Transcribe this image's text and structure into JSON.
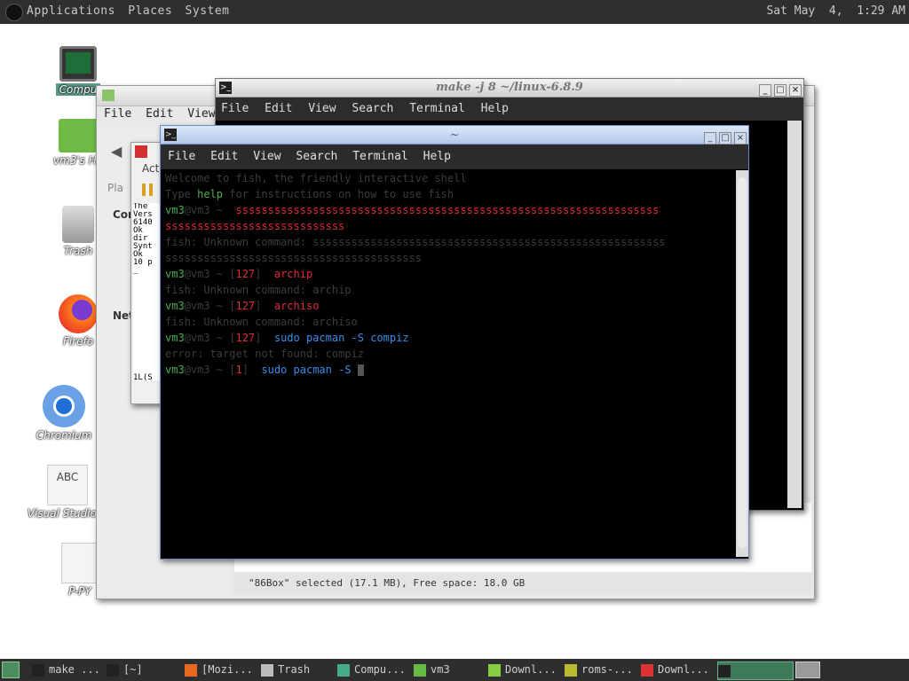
{
  "top_panel": {
    "menus": [
      "Applications",
      "Places",
      "System"
    ],
    "clock": "Sat May  4,  1:29 AM"
  },
  "desktop_icons": [
    {
      "label": "Compu",
      "icon": "computer-icon"
    },
    {
      "label": "vm3's Ho",
      "icon": "home-folder-icon"
    },
    {
      "label": "Trash",
      "icon": "trash-icon"
    },
    {
      "label": "Firefo",
      "icon": "firefox-icon"
    },
    {
      "label": "Chromium",
      "icon": "chromium-icon"
    },
    {
      "label": "Visual Studio C",
      "icon": "vscode-icon",
      "glyph": "ABC"
    },
    {
      "label": "P-PY",
      "icon": "file-icon"
    }
  ],
  "file_manager": {
    "menus": [
      "File",
      "Edit",
      "View"
    ],
    "status": "\"86Box\" selected (17.1 MB), Free space: 18.0 GB",
    "side_labels": [
      "Pla",
      "Cor",
      "Net"
    ],
    "toolbar_label": "Act"
  },
  "dialog": {
    "lines": [
      "The",
      "Vers",
      "6140",
      "Ok",
      "dir",
      "Synt",
      "Ok",
      "10 p",
      "_"
    ],
    "bottom": "1L(S"
  },
  "terminal_back": {
    "title": "make -j 8 ~/linux-6.8.9",
    "menus": [
      "File",
      "Edit",
      "View",
      "Search",
      "Terminal",
      "Help"
    ]
  },
  "terminal_main": {
    "title": "~",
    "menus": [
      "File",
      "Edit",
      "View",
      "Search",
      "Terminal",
      "Help"
    ],
    "lines": [
      {
        "parts": [
          {
            "t": "Welcome to fish, the friendly interactive shell",
            "c": "dim"
          }
        ]
      },
      {
        "parts": [
          {
            "t": "Type ",
            "c": "dim"
          },
          {
            "t": "help",
            "c": "green"
          },
          {
            "t": " for instructions on how to use fish",
            "c": "dim"
          }
        ]
      },
      {
        "parts": [
          {
            "t": "vm3",
            "c": "green"
          },
          {
            "t": "@vm3 ~ ",
            "c": "dim"
          },
          {
            "t": " ssssssssssssssssssssssssssssssssssssssssssssssssssssssssssssssssss",
            "c": "red"
          }
        ]
      },
      {
        "parts": [
          {
            "t": "ssssssssssssssssssssssssssss",
            "c": "red"
          }
        ]
      },
      {
        "parts": [
          {
            "t": "fish: Unknown command: sssssssssssssssssssssssssssssssssssssssssssssssssssssss",
            "c": "dim"
          }
        ]
      },
      {
        "parts": [
          {
            "t": "ssssssssssssssssssssssssssssssssssssssss",
            "c": "dim"
          }
        ]
      },
      {
        "parts": [
          {
            "t": "vm3",
            "c": "green"
          },
          {
            "t": "@vm3 ~ [",
            "c": "dim"
          },
          {
            "t": "127",
            "c": "red"
          },
          {
            "t": "] ",
            "c": "dim"
          },
          {
            "t": " archip",
            "c": "red"
          }
        ]
      },
      {
        "parts": [
          {
            "t": "fish: Unknown command: archip",
            "c": "dim"
          }
        ]
      },
      {
        "parts": [
          {
            "t": "vm3",
            "c": "green"
          },
          {
            "t": "@vm3 ~ [",
            "c": "dim"
          },
          {
            "t": "127",
            "c": "red"
          },
          {
            "t": "] ",
            "c": "dim"
          },
          {
            "t": " archiso",
            "c": "red"
          }
        ]
      },
      {
        "parts": [
          {
            "t": "fish: Unknown command: archiso",
            "c": "dim"
          }
        ]
      },
      {
        "parts": [
          {
            "t": "vm3",
            "c": "green"
          },
          {
            "t": "@vm3 ~ [",
            "c": "dim"
          },
          {
            "t": "127",
            "c": "red"
          },
          {
            "t": "] ",
            "c": "dim"
          },
          {
            "t": " sudo pacman -S compiz",
            "c": "blue"
          }
        ]
      },
      {
        "parts": [
          {
            "t": "error: target not found: compiz",
            "c": "dim"
          }
        ]
      },
      {
        "parts": [
          {
            "t": "vm3",
            "c": "green"
          },
          {
            "t": "@vm3 ~ [",
            "c": "dim"
          },
          {
            "t": "1",
            "c": "red"
          },
          {
            "t": "] ",
            "c": "dim"
          },
          {
            "t": " sudo pacman -S ",
            "c": "blue"
          }
        ]
      }
    ]
  },
  "taskbar": {
    "items": [
      {
        "label": "make ...",
        "icon": "terminal-icon"
      },
      {
        "label": "[~]",
        "icon": "terminal-icon"
      },
      {
        "label": "[Mozi...",
        "icon": "firefox-icon"
      },
      {
        "label": "Trash",
        "icon": "trash-icon"
      },
      {
        "label": "Compu...",
        "icon": "computer-icon"
      },
      {
        "label": "vm3",
        "icon": "home-folder-icon"
      },
      {
        "label": "Downl...",
        "icon": "folder-icon"
      },
      {
        "label": "roms-...",
        "icon": "archive-icon"
      },
      {
        "label": "Downl...",
        "icon": "app-icon"
      },
      {
        "label": "",
        "icon": "terminal-icon"
      }
    ]
  }
}
